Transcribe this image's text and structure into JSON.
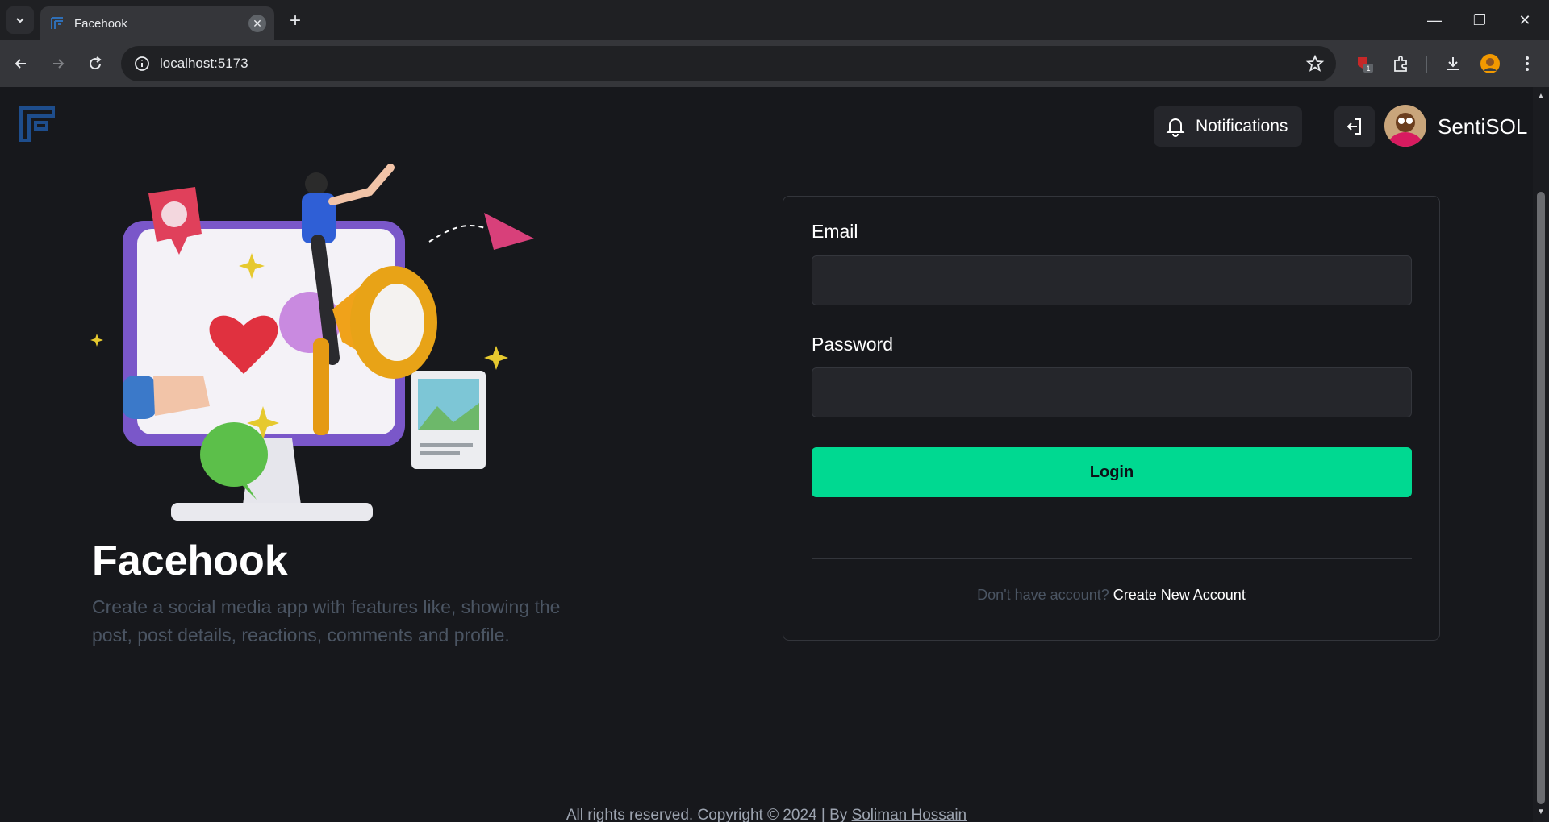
{
  "browser": {
    "tab_title": "Facehook",
    "url": "localhost:5173",
    "extension_badge": "1"
  },
  "header": {
    "notifications_label": "Notifications",
    "username": "SentiSOL"
  },
  "hero": {
    "brand": "Facehook",
    "description": "Create a social media app with features like, showing the post, post details, reactions, comments and profile."
  },
  "login": {
    "email_label": "Email",
    "email_value": "",
    "password_label": "Password",
    "password_value": "",
    "button_label": "Login",
    "no_account_text": "Don't have account?",
    "create_account_link": "Create New Account"
  },
  "footer": {
    "copyright": "All rights reserved. Copyright © 2024 | By",
    "author": "Soliman Hossain"
  },
  "colors": {
    "accent": "#00d991",
    "brand_logo": "#1e4d8c",
    "background": "#17181c"
  }
}
